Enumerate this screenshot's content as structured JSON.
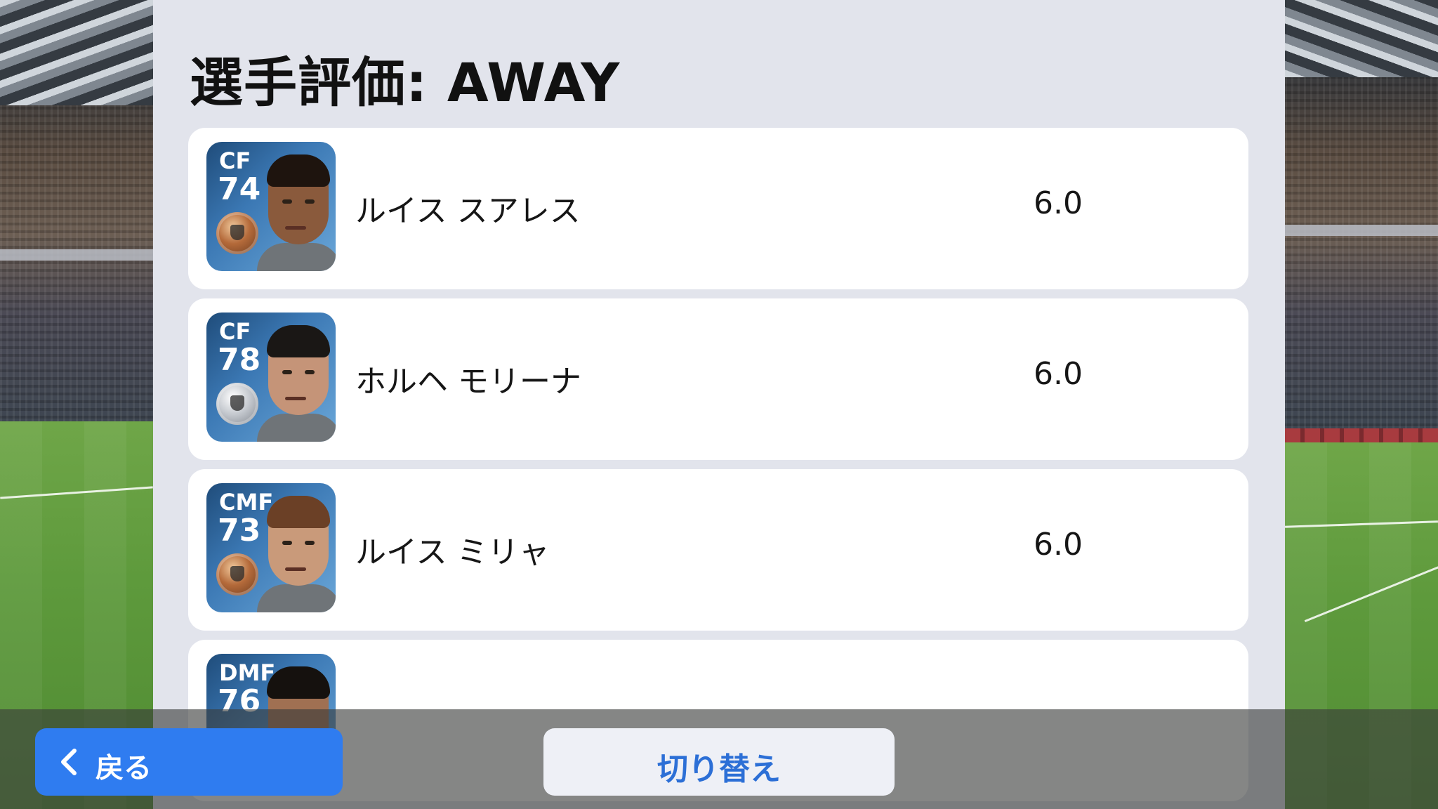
{
  "title": "選手評価: AWAY",
  "players": [
    {
      "position": "CF",
      "overall": "74",
      "name": "ルイス スアレス",
      "rating": "6.0",
      "medal": "bronze"
    },
    {
      "position": "CF",
      "overall": "78",
      "name": "ホルヘ モリーナ",
      "rating": "6.0",
      "medal": "silver"
    },
    {
      "position": "CMF",
      "overall": "73",
      "name": "ルイス ミリャ",
      "rating": "6.0",
      "medal": "bronze"
    },
    {
      "position": "DMF",
      "overall": "76",
      "name": "",
      "rating": "",
      "medal": ""
    }
  ],
  "buttons": {
    "back_label": "戻る",
    "switch_label": "切り替え"
  },
  "colors": {
    "panel": "#e2e4ec",
    "card": "#ffffff",
    "back_button": "#2f7cf0",
    "switch_text": "#2c6fd6"
  }
}
